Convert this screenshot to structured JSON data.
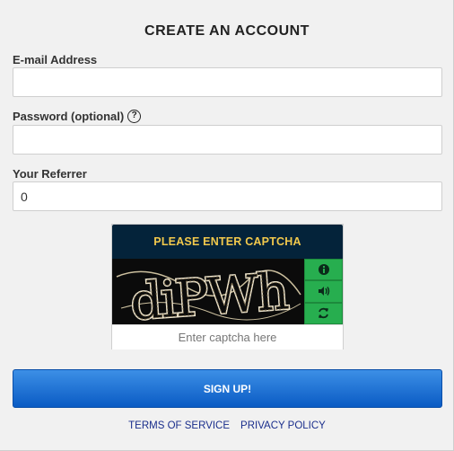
{
  "form": {
    "title": "CREATE AN ACCOUNT",
    "email": {
      "label": "E-mail Address",
      "value": "",
      "placeholder": ""
    },
    "password": {
      "label": "Password (optional)",
      "help_icon": "question-circle-icon",
      "value": ""
    },
    "referrer": {
      "label": "Your Referrer",
      "value": "0"
    }
  },
  "captcha": {
    "header": "PLEASE ENTER CAPTCHA",
    "image_text": "diPWh",
    "buttons": [
      "info-icon",
      "audio-icon",
      "refresh-icon"
    ],
    "input_placeholder": "Enter captcha here"
  },
  "signup_label": "SIGN UP!",
  "links": {
    "terms": "TERMS OF SERVICE",
    "privacy": "PRIVACY POLICY"
  },
  "colors": {
    "captcha_header_bg": "#04233a",
    "captcha_header_text": "#f2c94c",
    "captcha_button": "#27ae4f",
    "signup_button": "#0a5bc4",
    "link": "#1a2e8c"
  }
}
